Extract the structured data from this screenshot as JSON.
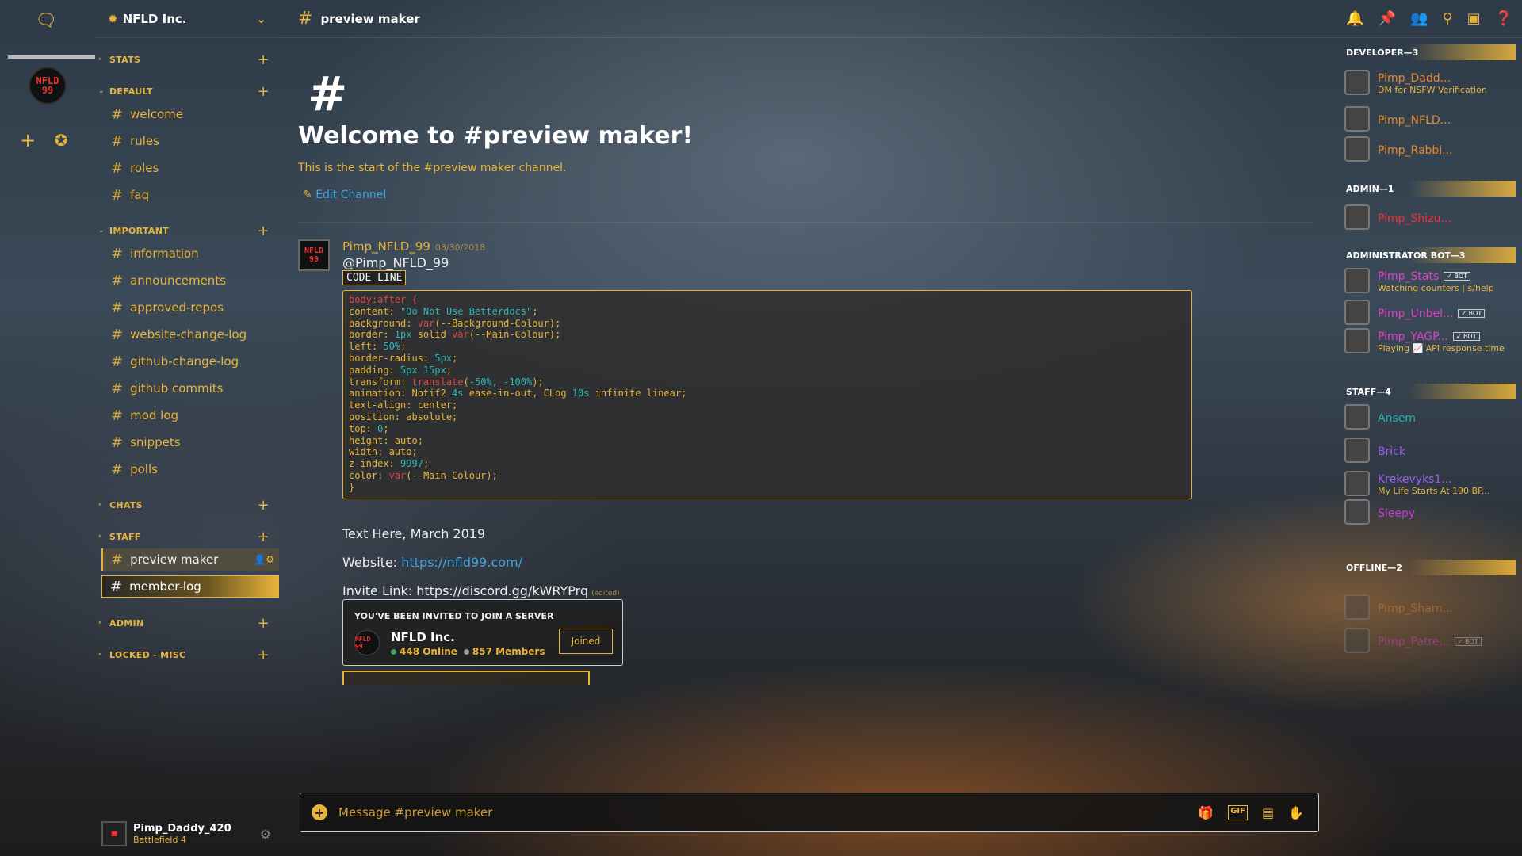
{
  "server": {
    "name": "NFLD Inc.",
    "icon_text": "NFLD 99"
  },
  "channels": {
    "categories": {
      "stats": "STATS",
      "default": "DEFAULT",
      "important": "IMPORTANT",
      "chats": "CHATS",
      "staff": "STAFF",
      "admin": "ADMIN",
      "locked": "LOCKED - MISC"
    },
    "default": [
      "welcome",
      "rules",
      "roles",
      "faq"
    ],
    "important": [
      "information",
      "announcements",
      "approved-repos",
      "website-change-log",
      "github-change-log",
      "github commits",
      "mod log",
      "snippets",
      "polls"
    ],
    "staff": [
      "preview maker",
      "member-log"
    ]
  },
  "user": {
    "name": "Pimp_Daddy_420",
    "status": "Battlefield 4"
  },
  "header": {
    "channel": "preview maker"
  },
  "welcome": {
    "title": "Welcome to #preview maker!",
    "subtitle": "This is the start of the #preview maker channel.",
    "edit": "Edit Channel"
  },
  "message": {
    "author": "Pimp_NFLD_99",
    "date": "08/30/2018",
    "mention": "@Pimp_NFLD_99",
    "code_label": "CODE LINE",
    "text1": "Text Here, March 2019",
    "website_label": "Website:",
    "website_url": "https://nfld99.com/",
    "invite_label": "Invite Link: https://discord.gg/kWRYPrq",
    "edited": "(edited)"
  },
  "code_lines": [
    [
      [
        "body:after {",
        "red"
      ]
    ],
    [
      [
        "content: ",
        "gold"
      ],
      [
        "\"Do Not Use Betterdocs\"",
        "cyan"
      ],
      [
        ";",
        "gold"
      ]
    ],
    [
      [
        "background: ",
        "gold"
      ],
      [
        "var",
        "red"
      ],
      [
        "(--Background-Colour);",
        "gold"
      ]
    ],
    [
      [
        "border: ",
        "gold"
      ],
      [
        "1px",
        "cyan"
      ],
      [
        " solid ",
        "gold"
      ],
      [
        "var",
        "red"
      ],
      [
        "(--Main-Colour);",
        "gold"
      ]
    ],
    [
      [
        "left: ",
        "gold"
      ],
      [
        "50%",
        "cyan"
      ],
      [
        ";",
        "gold"
      ]
    ],
    [
      [
        "border-radius: ",
        "gold"
      ],
      [
        "5px",
        "cyan"
      ],
      [
        ";",
        "gold"
      ]
    ],
    [
      [
        "padding: ",
        "gold"
      ],
      [
        "5px 15px",
        "cyan"
      ],
      [
        ";",
        "gold"
      ]
    ],
    [
      [
        "transform: ",
        "gold"
      ],
      [
        "translate",
        "red"
      ],
      [
        "(",
        "gold"
      ],
      [
        "-50%, -100%",
        "cyan"
      ],
      [
        ");",
        "gold"
      ]
    ],
    [
      [
        "animation: Notif2 ",
        "gold"
      ],
      [
        "4s",
        "cyan"
      ],
      [
        " ease-in-out, CLog ",
        "gold"
      ],
      [
        "10s",
        "cyan"
      ],
      [
        " infinite linear;",
        "gold"
      ]
    ],
    [
      [
        "text-align: center;",
        "gold"
      ]
    ],
    [
      [
        "position: absolute;",
        "gold"
      ]
    ],
    [
      [
        "top: ",
        "gold"
      ],
      [
        "0",
        "cyan"
      ],
      [
        ";",
        "gold"
      ]
    ],
    [
      [
        "height: auto;",
        "gold"
      ]
    ],
    [
      [
        "width: auto;",
        "gold"
      ]
    ],
    [
      [
        "z-index: ",
        "gold"
      ],
      [
        "9997",
        "cyan"
      ],
      [
        ";",
        "gold"
      ]
    ],
    [
      [
        "color: ",
        "gold"
      ],
      [
        "var",
        "red"
      ],
      [
        "(--Main-Colour);",
        "gold"
      ]
    ],
    [
      [
        "}",
        "gold"
      ]
    ]
  ],
  "invite": {
    "heading": "YOU'VE BEEN INVITED TO JOIN A SERVER",
    "server": "NFLD Inc.",
    "online": "448 Online",
    "members": "857 Members",
    "button": "Joined"
  },
  "composer": {
    "placeholder": "Message #preview maker",
    "gif": "GIF"
  },
  "members": {
    "groups": [
      {
        "label": "DEVELOPER—3"
      },
      {
        "label": "ADMIN—1"
      },
      {
        "label": "ADMINISTRATOR BOT—3"
      },
      {
        "label": "STAFF—4"
      },
      {
        "label": "OFFLINE—2"
      }
    ],
    "list": [
      {
        "name": "Pimp_Dadd...",
        "status": "DM for NSFW Verification",
        "color": "orange"
      },
      {
        "name": "Pimp_NFLD...",
        "status": "",
        "color": "orange"
      },
      {
        "name": "Pimp_Rabbi...",
        "status": "",
        "color": "orange"
      },
      {
        "name": "Pimp_Shizu...",
        "status": "",
        "color": "red"
      },
      {
        "name": "Pimp_Stats",
        "status": "Watching counters | s/help",
        "color": "pink",
        "bot": "✓ BOT"
      },
      {
        "name": "Pimp_Unbel...",
        "status": "",
        "color": "pink",
        "bot": "✓ BOT"
      },
      {
        "name": "Pimp_YAGP...",
        "status": "Playing 📈 API response time",
        "color": "pink",
        "bot": "✓ BOT"
      },
      {
        "name": "Ansem",
        "status": "",
        "color": "teal"
      },
      {
        "name": "Brick",
        "status": "",
        "color": "purple"
      },
      {
        "name": "Krekevyks1...",
        "status": "My Life Starts At 190 BP...",
        "color": "purple"
      },
      {
        "name": "Sleepy",
        "status": "",
        "color": "magenta"
      },
      {
        "name": "Pimp_Sham...",
        "status": "",
        "color": "orange"
      },
      {
        "name": "Pimp_Patre...",
        "status": "",
        "color": "pink",
        "bot": "✓ BOT"
      }
    ]
  }
}
